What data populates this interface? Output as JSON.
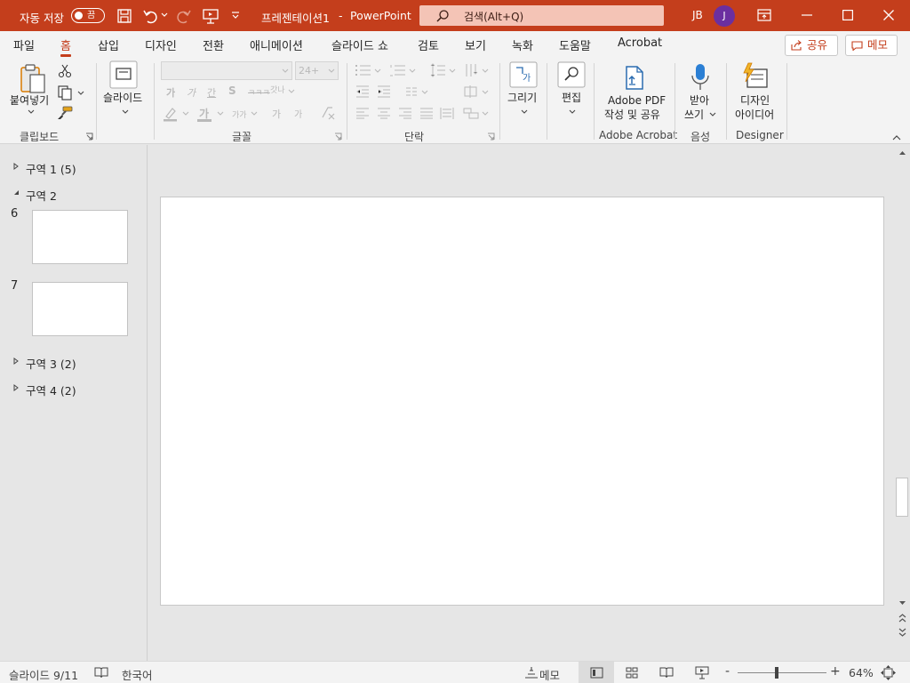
{
  "titlebar": {
    "autosave_label": "자동 저장",
    "autosave_state": "끔",
    "doc_title": "프레젠테이션1",
    "separator": "-",
    "app_name": "PowerPoint",
    "search_placeholder": "검색(Alt+Q)",
    "user_initials": "JB",
    "avatar_letter": "J"
  },
  "tabs": [
    "파일",
    "홈",
    "삽입",
    "디자인",
    "전환",
    "애니메이션",
    "슬라이드 쇼",
    "검토",
    "보기",
    "녹화",
    "도움말",
    "Acrobat"
  ],
  "active_tab": "홈",
  "share_label": "공유",
  "comments_label": "메모",
  "ribbon": {
    "paste_label": "붙여넣기",
    "clipboard_group": "클립보드",
    "slides_label": "슬라이드",
    "font_size": "24+",
    "font_group": "글꼴",
    "paragraph_group": "단락",
    "drawing_label": "그리기",
    "editing_label": "편집",
    "adobe_label_1": "Adobe PDF",
    "adobe_label_2": "작성 및 공유",
    "adobe_group": "Adobe Acrobat",
    "dictate_label_1": "받아",
    "dictate_label_2": "쓰기",
    "voice_group": "음성",
    "designer_label_1": "디자인",
    "designer_label_2": "아이디어",
    "designer_group": "Designer",
    "bold_glyph": "가",
    "italic_glyph": "가",
    "underline_glyph": "간",
    "strike_glyph": "S",
    "strike2_glyph": "ㅋㅋㅋ",
    "spacing_glyph": "갓나",
    "fontcolor_glyph": "가",
    "case_glyph": "가가",
    "grow_glyph": "가",
    "shrink_glyph": "가"
  },
  "sections": [
    {
      "name": "구역 1 (5)",
      "expanded": false
    },
    {
      "name": "구역 2",
      "expanded": true
    },
    {
      "name": "구역 3 (2)",
      "expanded": false
    },
    {
      "name": "구역 4 (2)",
      "expanded": false
    }
  ],
  "slide_numbers": [
    "6",
    "7"
  ],
  "status": {
    "slide_counter": "슬라이드 9/11",
    "language": "한국어",
    "notes_label": "메모",
    "zoom": "64%",
    "zoom_minus": "-",
    "zoom_plus": "+",
    "zoom_slider_fraction": 0.64
  },
  "colors": {
    "accent": "#c43e1c",
    "avatar": "#6b2fa0",
    "search_bg": "#f4c4b6"
  }
}
